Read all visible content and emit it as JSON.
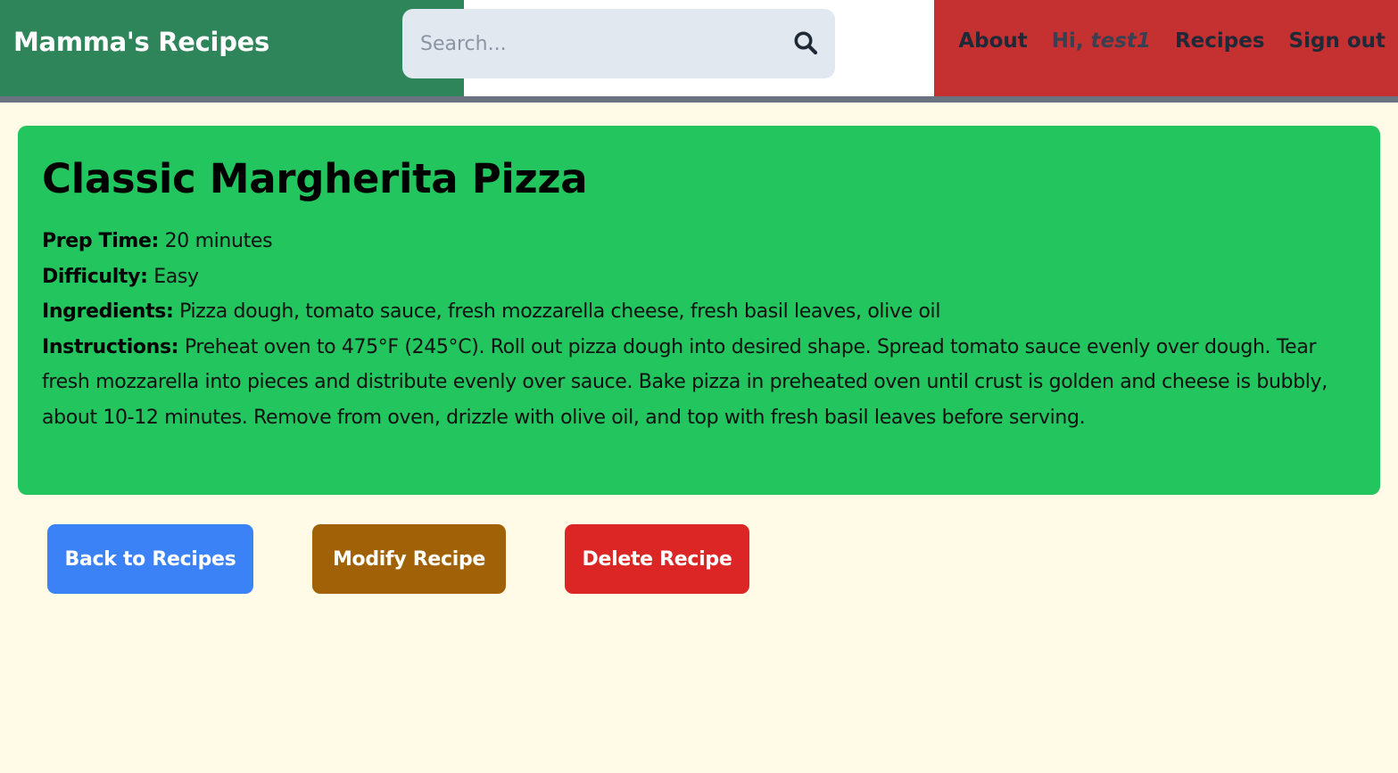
{
  "header": {
    "brand": "Mamma's Recipes",
    "search": {
      "placeholder": "Search...",
      "icon": "search-icon"
    },
    "nav": {
      "about": "About",
      "greeting_prefix": "Hi, ",
      "username": "test1",
      "recipes": "Recipes",
      "sign_out": "Sign out"
    },
    "colors": {
      "green": "#2e855a",
      "white": "#ffffff",
      "red": "#c53030"
    }
  },
  "recipe": {
    "title": "Classic Margherita Pizza",
    "prep_time_label": "Prep Time:",
    "prep_time": "20 minutes",
    "difficulty_label": "Difficulty:",
    "difficulty": "Easy",
    "ingredients_label": "Ingredients:",
    "ingredients": "Pizza dough, tomato sauce, fresh mozzarella cheese, fresh basil leaves, olive oil",
    "instructions_label": "Instructions:",
    "instructions": "Preheat oven to 475°F (245°C). Roll out pizza dough into desired shape. Spread tomato sauce evenly over dough. Tear fresh mozzarella into pieces and distribute evenly over sauce. Bake pizza in preheated oven until crust is golden and cheese is bubbly, about 10-12 minutes. Remove from oven, drizzle with olive oil, and top with fresh basil leaves before serving."
  },
  "actions": {
    "back": "Back to Recipes",
    "modify": "Modify Recipe",
    "delete": "Delete Recipe"
  }
}
